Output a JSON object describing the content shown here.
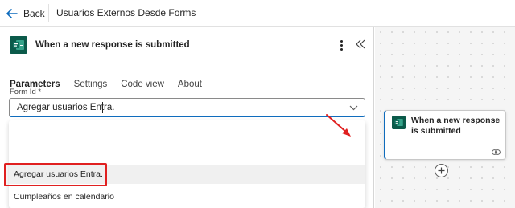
{
  "topbar": {
    "back_label": "Back",
    "flow_title": "Usuarios Externos Desde Forms"
  },
  "panel": {
    "title": "When a new response is submitted",
    "tabs": [
      {
        "label": "Parameters",
        "active": true
      },
      {
        "label": "Settings",
        "active": false
      },
      {
        "label": "Code view",
        "active": false
      },
      {
        "label": "About",
        "active": false
      }
    ],
    "form_id": {
      "label": "Form Id *",
      "value": "Agregar usuarios Entra."
    },
    "dropdown": {
      "options": [
        {
          "label": "Agregar usuarios Entra.",
          "highlighted": true
        },
        {
          "label": "Cumpleaños en calendario",
          "highlighted": false
        }
      ]
    }
  },
  "canvas": {
    "card_title": "When a new response is submitted"
  },
  "colors": {
    "accent": "#0f6cbd",
    "forms_icon": "#0b5a4a",
    "annotation_red": "#e02020"
  }
}
